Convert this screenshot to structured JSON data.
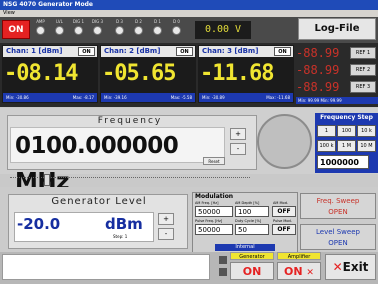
{
  "window": {
    "title": "NSG 4070    Generator Mode",
    "menu": "View"
  },
  "top": {
    "on_label": "ON",
    "indicators": [
      "AMP",
      "LVL",
      "DIG 1",
      "DIG 3",
      "D 3",
      "D 2",
      "D 1",
      "D 0"
    ],
    "voltage": "0.00 V",
    "log_file": "Log-File"
  },
  "channels": [
    {
      "title": "Chan: 1 [dBm]",
      "on": "ON",
      "value": "-08.14",
      "min": "Min: -30.86",
      "max": "Max: -8.17"
    },
    {
      "title": "Chan: 2 [dBm]",
      "on": "ON",
      "value": "-05.65",
      "min": "Min: -39.16",
      "max": "Max: -5.58"
    },
    {
      "title": "Chan: 3 [dBm]",
      "on": "ON",
      "value": "-11.68",
      "min": "Min: -30.89",
      "max": "Max: -11.68"
    }
  ],
  "refs": [
    {
      "value": "-88.99",
      "label": "REF 1"
    },
    {
      "value": "-88.99",
      "label": "REF 2"
    },
    {
      "value": "-88.99",
      "label": "REF 3"
    }
  ],
  "ref_minmax": "Min: 99.99   Min: 99.99",
  "frequency": {
    "label": "Frequency",
    "value": "0100.000000 MHz",
    "reset": "Reset",
    "up": "+",
    "down": "-"
  },
  "freq_step": {
    "title": "Frequency Step",
    "buttons": [
      "1",
      "100",
      "10 k",
      "100 k",
      "1 M",
      "10 M"
    ],
    "value": "1000000"
  },
  "generator": {
    "label": "Generator Level",
    "value": "-20.0",
    "unit": "dBm",
    "step": "Step:  1"
  },
  "modulation": {
    "title": "Modulation",
    "am_freq_label": "AM Freq. [Hz]",
    "am_freq": "50000",
    "am_depth_label": "AM Depth [%]",
    "am_depth": "100",
    "am_mod_label": "AM Mod.",
    "am_mod": "OFF",
    "pulse_freq_label": "Pulse Freq. [Hz]",
    "pulse_freq": "50000",
    "duty_label": "Duty Cycle [%]",
    "duty": "50",
    "pulse_mod_label": "Pulse Mod.",
    "pulse_mod": "OFF",
    "internal": "Internal"
  },
  "sweeps": {
    "freq_line1": "Freq. Sweep",
    "freq_line2": "OPEN",
    "level_line1": "Level Sweep",
    "level_line2": "OPEN"
  },
  "bottom": {
    "generator_label": "Generator",
    "generator_on": "ON",
    "amplifier_label": "Amplifier",
    "amplifier_on": "ON",
    "exit": "Exit"
  },
  "colors": {
    "red": "#e52222",
    "blue": "#1d39b0",
    "yellow": "#f0e531"
  }
}
